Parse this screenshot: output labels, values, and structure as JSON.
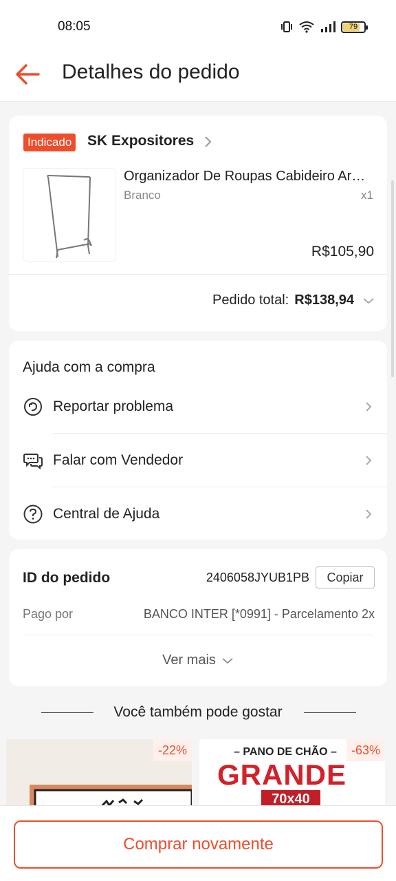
{
  "status_bar": {
    "time": "08:05",
    "battery": "79"
  },
  "header": {
    "title": "Detalhes do pedido"
  },
  "product_card": {
    "badge": "Indicado",
    "shop_name": "SK Expositores",
    "product_name": "Organizador De Roupas Cabideiro Arara Para Loja",
    "variant": "Branco",
    "quantity": "x1",
    "price": "R$105,90",
    "total_label": "Pedido total:",
    "total_value": "R$138,94"
  },
  "help_card": {
    "title": "Ajuda com a compra",
    "items": [
      {
        "label": "Reportar problema",
        "icon": "refresh-warning-icon"
      },
      {
        "label": "Falar com Vendedor",
        "icon": "chat-icon"
      },
      {
        "label": "Central de Ajuda",
        "icon": "question-icon"
      }
    ]
  },
  "order_card": {
    "id_label": "ID do pedido",
    "id_value": "2406058JYUB1PB",
    "copy_label": "Copiar",
    "paid_label": "Pago por",
    "paid_value": "BANCO INTER [*0991] - Parcelamento 2x",
    "see_more": "Ver mais"
  },
  "suggestions": {
    "title": "Você também pode gostar",
    "items": [
      {
        "discount": "-22%"
      },
      {
        "discount": "-63%",
        "promo_small": "– PANO DE CHÃO –",
        "promo_big": "GRANDE",
        "promo_size": "70x40"
      }
    ]
  },
  "bottom": {
    "buy_again": "Comprar novamente"
  },
  "colors": {
    "accent": "#ee4d2d",
    "background": "#f5f5f5"
  }
}
